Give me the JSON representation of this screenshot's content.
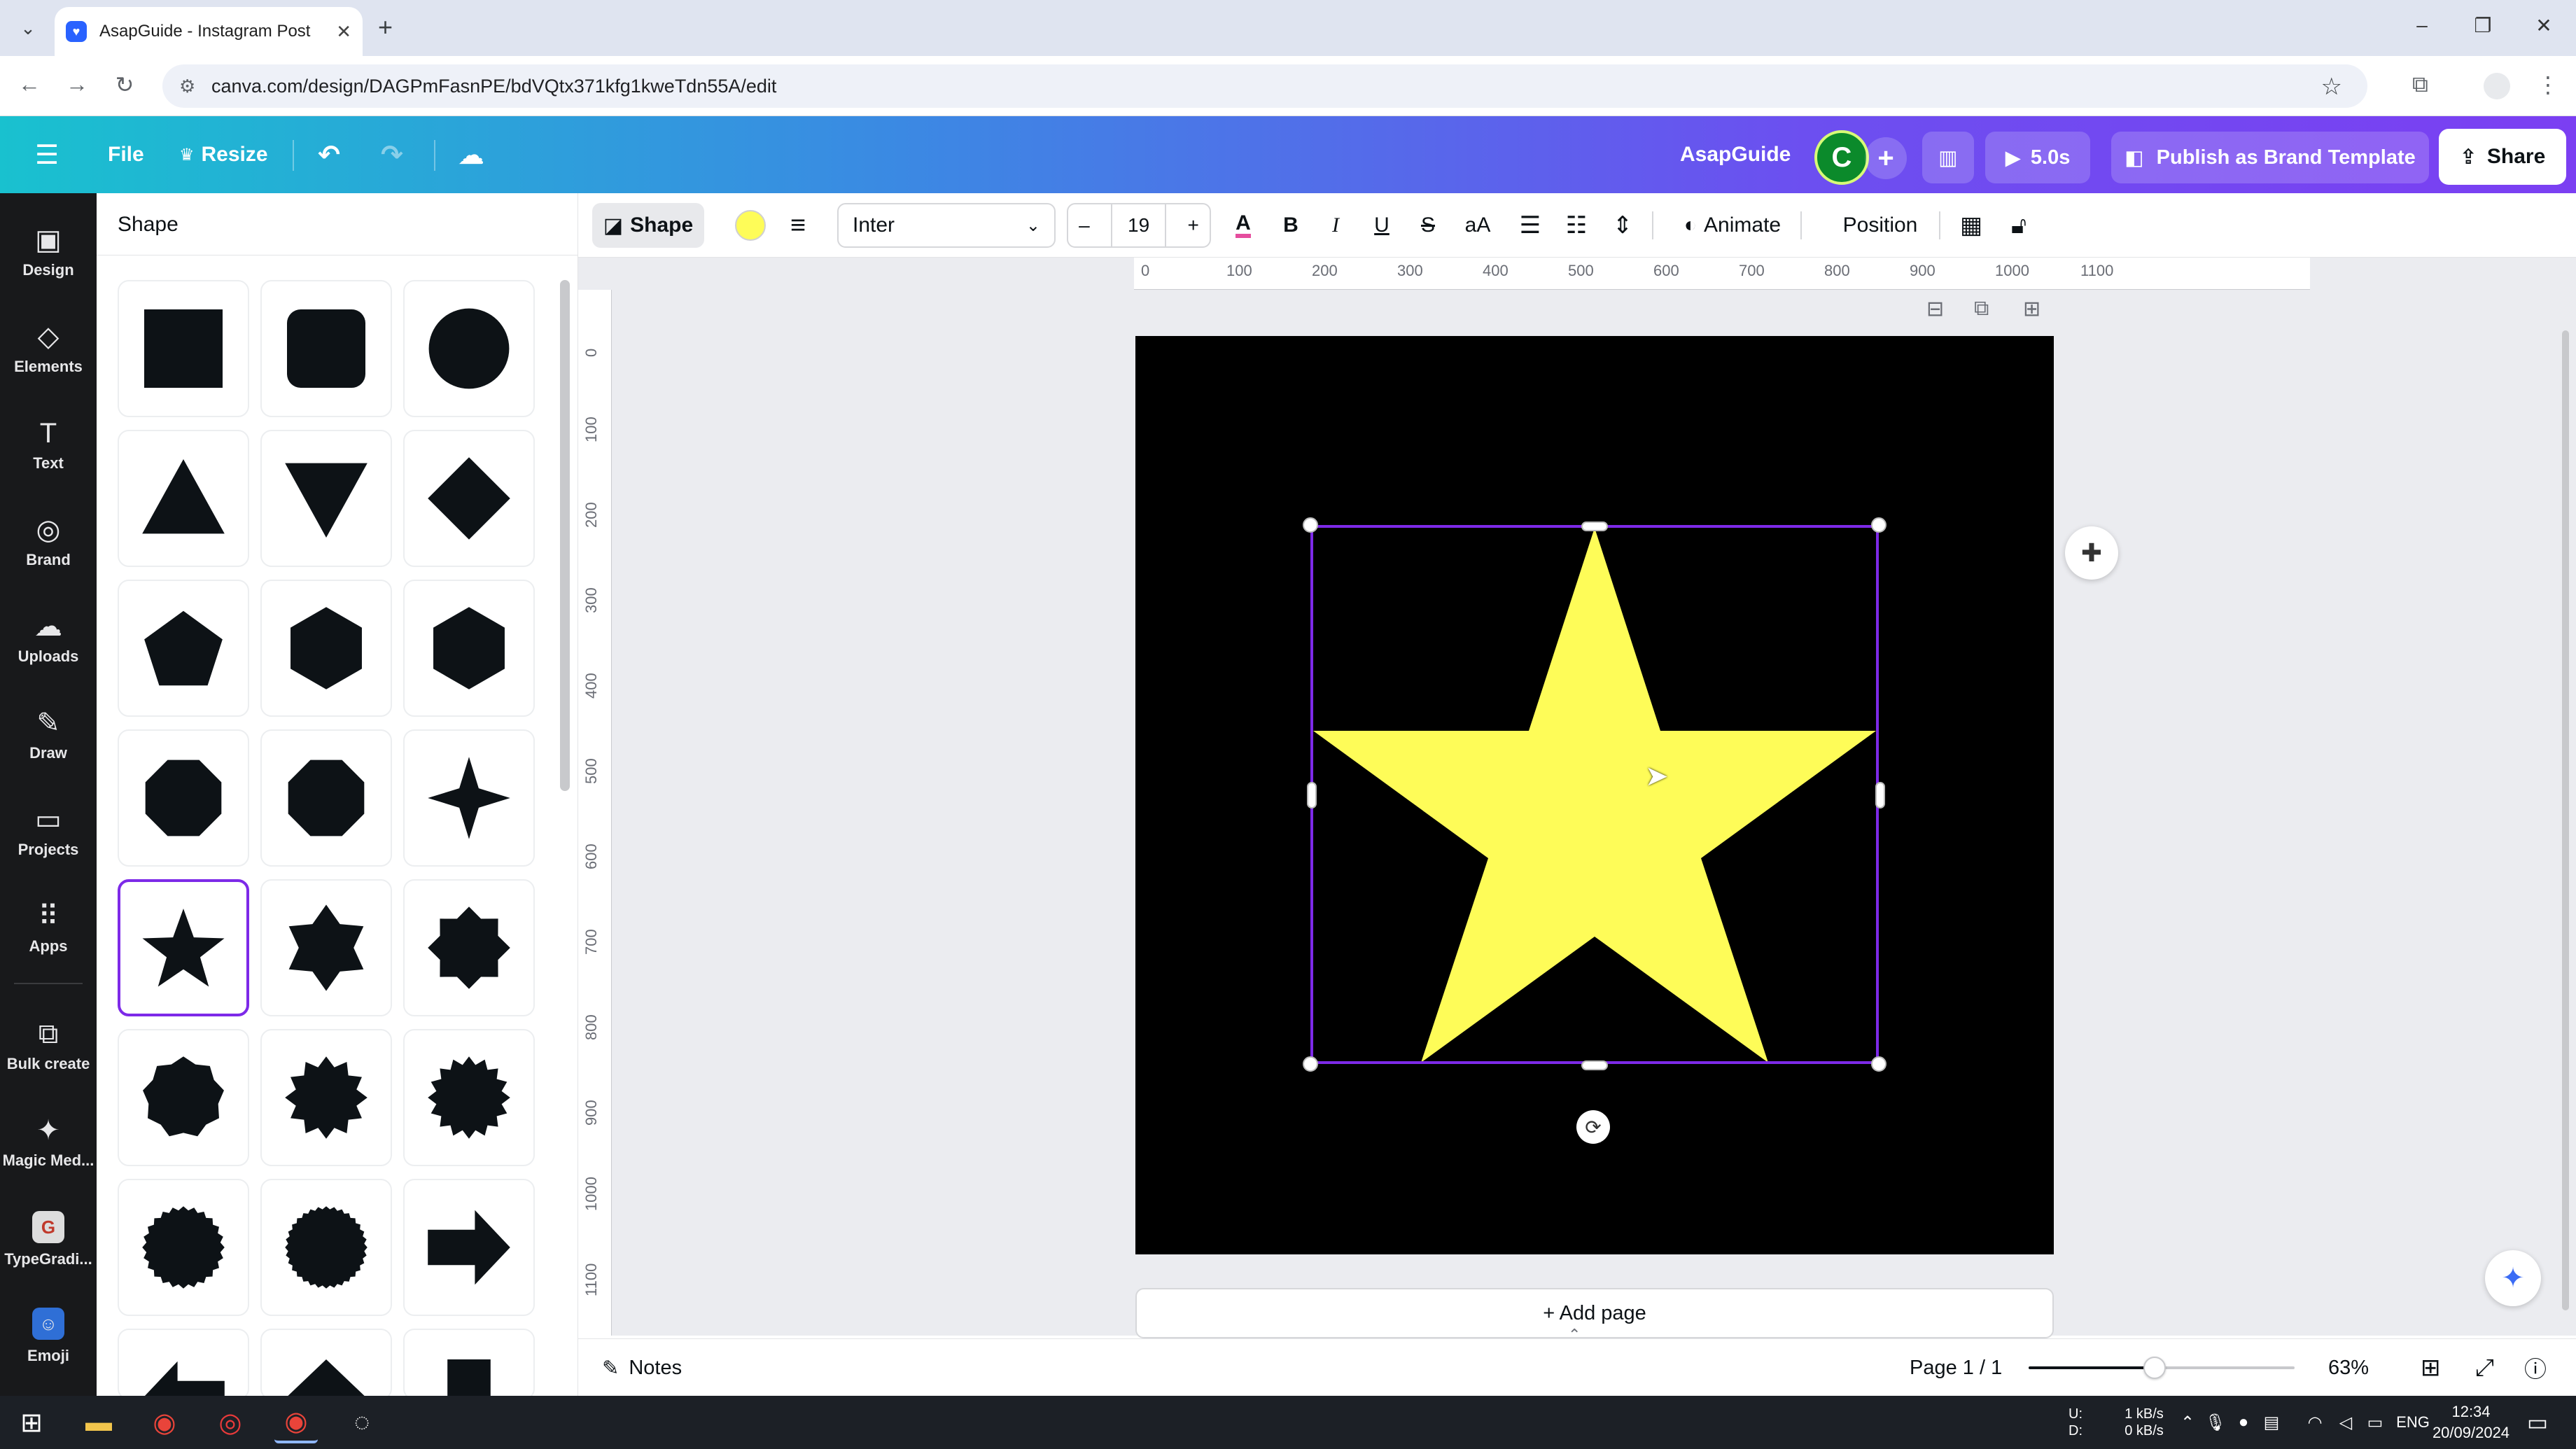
{
  "browser": {
    "tab_title": "AsapGuide - Instagram Post",
    "url": "canva.com/design/DAGPmFasnPE/bdVQtx371kfg1kweTdn55A/edit",
    "icons": {
      "tab_menu": "chevron-down-icon",
      "new_tab": "plus-icon",
      "back": "arrow-left-icon",
      "forward": "arrow-right-icon",
      "reload": "reload-icon",
      "site_info": "tune-icon",
      "bookmark": "star-icon",
      "extensions": "puzzle-icon",
      "menu": "kebab-icon"
    }
  },
  "header": {
    "file_label": "File",
    "resize_label": "Resize",
    "team_name": "AsapGuide",
    "avatar_letter": "C",
    "play_duration": "5.0s",
    "publish_label": "Publish as Brand Template",
    "share_label": "Share",
    "colors": {
      "gradient_start": "#19c1cf",
      "gradient_end": "#7b3ff2",
      "avatar_bg": "#0b8a2b"
    }
  },
  "rail": {
    "items": [
      {
        "label": "Design",
        "icon": "design-icon"
      },
      {
        "label": "Elements",
        "icon": "elements-icon"
      },
      {
        "label": "Text",
        "icon": "text-icon"
      },
      {
        "label": "Brand",
        "icon": "brand-icon"
      },
      {
        "label": "Uploads",
        "icon": "cloud-upload-icon"
      },
      {
        "label": "Draw",
        "icon": "pen-icon"
      },
      {
        "label": "Projects",
        "icon": "folder-icon"
      },
      {
        "label": "Apps",
        "icon": "apps-grid-icon"
      },
      {
        "label": "Bulk create",
        "icon": "bulk-create-icon"
      },
      {
        "label": "Magic Med...",
        "icon": "magic-media-icon"
      },
      {
        "label": "TypeGradi...",
        "icon": "typegradient-icon"
      },
      {
        "label": "Emoji",
        "icon": "emoji-icon"
      }
    ]
  },
  "panel": {
    "title": "Shape",
    "shapes": [
      "square",
      "rounded-square",
      "circle",
      "triangle",
      "triangle-down",
      "diamond",
      "pentagon",
      "hexagon-vertical",
      "hexagon-horizontal",
      "octagon",
      "octagon-rotated",
      "four-point-star",
      "five-point-star",
      "six-point-star",
      "eight-point-star",
      "nonagon-badge",
      "starburst-12",
      "starburst-16",
      "seal-24",
      "seal-32",
      "arrow-right",
      "arrow-left",
      "chevron-up",
      "rectangle-tall"
    ],
    "selected_shape": "five-point-star"
  },
  "toolbar": {
    "shape_label": "Shape",
    "fill_color": "#fefc58",
    "font_name": "Inter",
    "font_size": "19",
    "decrease_label": "–",
    "increase_label": "+",
    "bold_label": "B",
    "italic_label": "I",
    "underline_label": "U",
    "strike_label": "S",
    "case_label": "aA",
    "animate_label": "Animate",
    "position_label": "Position"
  },
  "canvas": {
    "ruler_h": [
      "0",
      "100",
      "200",
      "300",
      "400",
      "500",
      "600",
      "700",
      "800",
      "900",
      "1000",
      "1100"
    ],
    "ruler_v": [
      "0",
      "100",
      "200",
      "300",
      "400",
      "500",
      "600",
      "700",
      "800",
      "900",
      "1000",
      "1100"
    ],
    "page_background": "#000000",
    "star_color": "#fefc58",
    "add_page_label": "+ Add page"
  },
  "bottombar": {
    "notes_label": "Notes",
    "page_indicator": "Page 1 / 1",
    "zoom_level": "63%",
    "zoom_fraction": 0.63
  },
  "taskbar": {
    "net_up": "U:",
    "net_down": "D:",
    "net_up_rate": "1 kB/s",
    "net_down_rate": "0 kB/s",
    "language": "ENG",
    "time": "12:34",
    "date": "20/09/2024"
  }
}
